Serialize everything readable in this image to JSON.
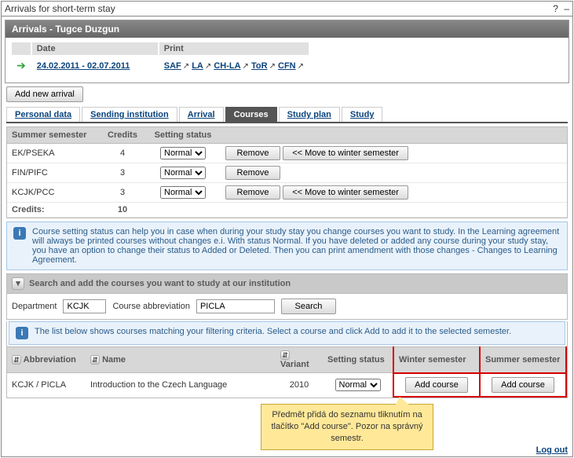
{
  "window": {
    "title": "Arrivals for short-term stay"
  },
  "panel": {
    "title": "Arrivals - Tugce Duzgun"
  },
  "detail": {
    "cols": {
      "date": "Date",
      "print": "Print"
    },
    "row": {
      "date_range": "24.02.2011 - 02.07.2011",
      "print_links": [
        "SAF",
        "LA",
        "CH-LA",
        "ToR",
        "CFN"
      ]
    }
  },
  "buttons": {
    "add_new_arrival": "Add new arrival",
    "search": "Search",
    "remove": "Remove",
    "move_to_winter": "<< Move to winter semester",
    "add_course": "Add course"
  },
  "tabs": [
    "Personal data",
    "Sending institution",
    "Arrival",
    "Courses",
    "Study plan",
    "Study"
  ],
  "active_tab": "Courses",
  "courses": {
    "cols": [
      "Summer semester",
      "Credits",
      "Setting status"
    ],
    "rows": [
      {
        "abbr": "EK/PSEKA",
        "credits": "4",
        "status": "Normal",
        "show_move": true
      },
      {
        "abbr": "FIN/PIFC",
        "credits": "3",
        "status": "Normal",
        "show_move": false
      },
      {
        "abbr": "KCJK/PCC",
        "credits": "3",
        "status": "Normal",
        "show_move": true
      }
    ],
    "totals": {
      "label": "Credits:",
      "value": "10"
    }
  },
  "info_status": "Course setting status can help you in case when during your study stay you change courses you want to study. In the Learning agreement will always be printed courses without changes e.i. With status Normal. If you have deleted or added any course during your study stay, you have an option to change their status to Added or Deleted. Then you can print amendment with those changes - Changes to Learning Agreement.",
  "search": {
    "title": "Search and add the courses you want to study at our institution",
    "department_label": "Department",
    "department_value": "KCJK",
    "course_abbr_label": "Course abbreviation",
    "course_abbr_value": "PICLA"
  },
  "info_filter": "The list below shows courses matching your filtering criteria. Select a course and click Add to add it to the selected semester.",
  "results": {
    "cols": [
      "Abbreviation",
      "Name",
      "Variant",
      "Setting status",
      "Winter semester",
      "Summer semester"
    ],
    "rows": [
      {
        "abbr": "KCJK / PICLA",
        "name": "Introduction to the Czech Language",
        "variant": "2010",
        "status": "Normal"
      }
    ]
  },
  "tooltip": "Předmět přidá do seznamu tliknutím na tlačítko \"Add course\". Pozor na správný semestr.",
  "footer": {
    "logout": "Log out"
  }
}
